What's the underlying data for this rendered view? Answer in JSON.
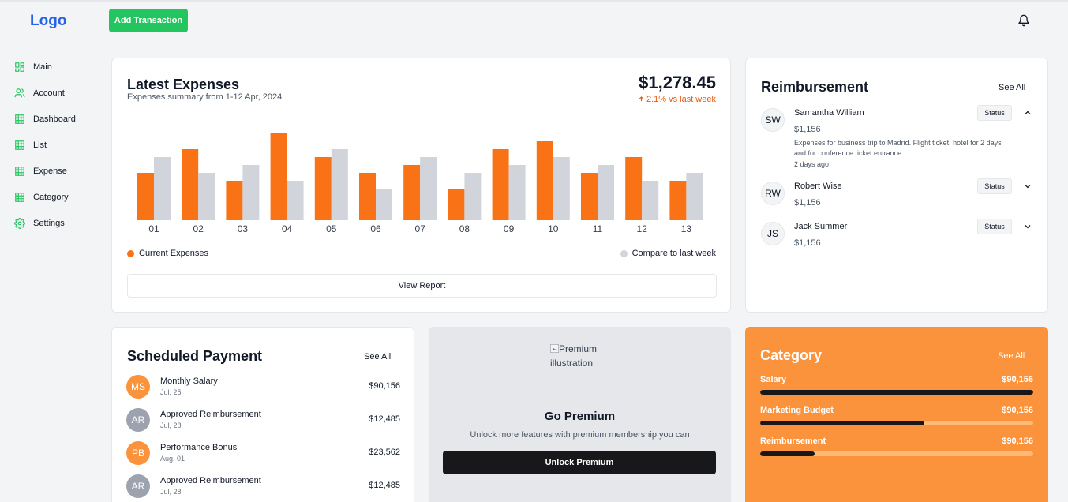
{
  "header": {
    "logo": "Logo",
    "add_transaction": "Add Transaction"
  },
  "sidebar": {
    "items": [
      {
        "label": "Main",
        "icon": "grid-icon"
      },
      {
        "label": "Account",
        "icon": "users-icon"
      },
      {
        "label": "Dashboard",
        "icon": "table-icon"
      },
      {
        "label": "List",
        "icon": "table-icon"
      },
      {
        "label": "Expense",
        "icon": "table-icon"
      },
      {
        "label": "Category",
        "icon": "table-icon"
      },
      {
        "label": "Settings",
        "icon": "gear-icon"
      }
    ]
  },
  "expenses": {
    "title": "Latest Expenses",
    "subtitle": "Expenses summary from 1-12 Apr, 2024",
    "total": "$1,278.45",
    "change": "2.1% vs last week",
    "legend_current": "Current Expenses",
    "legend_compare": "Compare to last week",
    "view_report": "View Report"
  },
  "chart_data": {
    "type": "bar",
    "categories": [
      "01",
      "02",
      "03",
      "04",
      "05",
      "06",
      "07",
      "08",
      "09",
      "10",
      "11",
      "12",
      "13"
    ],
    "series": [
      {
        "name": "Current Expenses",
        "values": [
          60,
          90,
          50,
          110,
          80,
          60,
          70,
          40,
          90,
          100,
          60,
          80,
          50
        ]
      },
      {
        "name": "Compare to last week",
        "values": [
          80,
          60,
          70,
          50,
          90,
          40,
          80,
          60,
          70,
          80,
          70,
          50,
          60
        ]
      }
    ],
    "colors": {
      "current": "#f97316",
      "compare": "#d1d5db"
    },
    "ylim": [
      0,
      110
    ],
    "grid": false,
    "legend": "bottom"
  },
  "reimbursement": {
    "title": "Reimbursement",
    "see_all": "See All",
    "items": [
      {
        "initials": "SW",
        "name": "Samantha William",
        "amount": "$1,156",
        "description": "Expenses for business trip to Madrid. Flight ticket, hotel for 2 days and for conference ticket entrance.",
        "date": "2 days ago",
        "status": "Status"
      },
      {
        "initials": "RW",
        "name": "Robert Wise",
        "amount": "$1,156",
        "status": "Status"
      },
      {
        "initials": "JS",
        "name": "Jack Summer",
        "amount": "$1,156",
        "status": "Status"
      }
    ]
  },
  "scheduled": {
    "title": "Scheduled Payment",
    "see_all": "See All",
    "items": [
      {
        "initials": "MS",
        "name": "Monthly Salary",
        "date": "Jul, 25",
        "amount": "$90,156",
        "color": "#fb923c"
      },
      {
        "initials": "AR",
        "name": "Approved Reimbursement",
        "date": "Jul, 28",
        "amount": "$12,485",
        "color": "#9ca3af"
      },
      {
        "initials": "PB",
        "name": "Performance Bonus",
        "date": "Aug, 01",
        "amount": "$23,562",
        "color": "#fb923c"
      },
      {
        "initials": "AR",
        "name": "Approved Reimbursement",
        "date": "Jul, 28",
        "amount": "$12,485",
        "color": "#9ca3af"
      }
    ]
  },
  "premium": {
    "image_alt_line1": "Premium",
    "image_alt_line2": "illustration",
    "title": "Go Premium",
    "subtitle": "Unlock more features with premium membership you can",
    "button": "Unlock Premium"
  },
  "category": {
    "title": "Category",
    "see_all": "See All",
    "items": [
      {
        "label": "Salary",
        "value": "$90,156",
        "progress": 1.0
      },
      {
        "label": "Marketing Budget",
        "value": "$90,156",
        "progress": 0.6
      },
      {
        "label": "Reimbursement",
        "value": "$90,156",
        "progress": 0.2
      }
    ]
  },
  "colors": {
    "brand": "#2563eb",
    "accent_green": "#22c55e",
    "accent_orange": "#f97316"
  }
}
